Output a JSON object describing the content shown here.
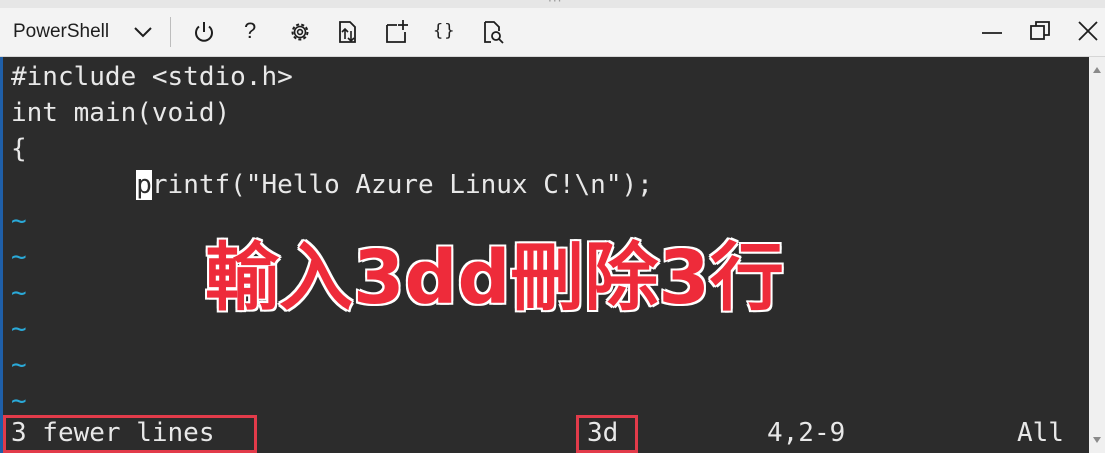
{
  "toolbar": {
    "shell_label": "PowerShell",
    "icons": [
      "chevron-down-icon",
      "power-icon",
      "help-icon",
      "settings-icon",
      "upload-download-icon",
      "new-session-icon",
      "braces-icon",
      "web-preview-icon"
    ],
    "help_glyph": "?",
    "braces_glyph": "{}"
  },
  "window_controls": [
    "minimize-icon",
    "restore-icon",
    "close-icon"
  ],
  "editor": {
    "lines": [
      "#include <stdio.h>",
      "int main(void)",
      "{",
      "        printf(\"Hello Azure Linux C!\\n\");"
    ],
    "cursor_line_indent": "        ",
    "cursor_char": "p",
    "cursor_line_rest": "rintf(\"Hello Azure Linux C!\\n\");",
    "tilde": "~"
  },
  "overlay": {
    "text": "輸入3dd刪除3行",
    "color": "#ee2b3a"
  },
  "status_bar": {
    "message": "3 fewer lines",
    "command": "3d",
    "position": "4,2-9",
    "scroll": "All"
  },
  "colors": {
    "terminal_bg": "#2c2c2c",
    "tilde": "#2aa9d8",
    "highlight_box": "#e23b4a",
    "accent": "#1f5fa8"
  }
}
